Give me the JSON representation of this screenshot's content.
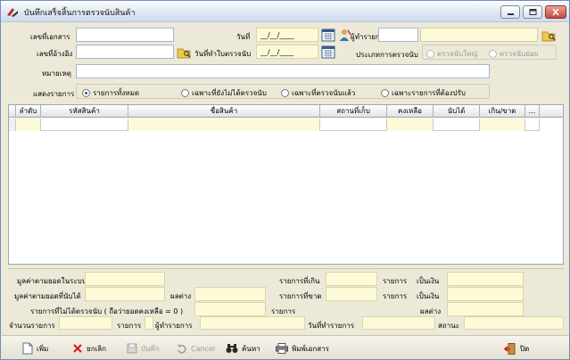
{
  "window": {
    "title": "บันทึกเสร็จสิ้นการตรวจนับสินค้า"
  },
  "form": {
    "doc_no_label": "เลขที่เอกสาร",
    "ref_no_label": "เลขที่อ้างอิง",
    "date_label": "วันที่",
    "date_value": "__/__/____",
    "count_date_label": "วันที่ทำใบตรวจนับ",
    "count_date_value": "__/__/____",
    "recorder_label": "ผู้ทำรายการ",
    "count_type_label": "ประเภทการตรวจนับ",
    "count_type_options": [
      "ตรวจนับใหญ่",
      "ตรวจนับย่อย"
    ],
    "note_label": "หมายเหตุ",
    "show_label": "แสดงรายการ",
    "show_options": [
      "รายการทั้งหมด",
      "เฉพาะที่ยังไม่ได้ตรวจนับ",
      "เฉพาะที่ตรวจนับแล้ว",
      "เฉพาะรายการที่ต้องปรับ"
    ],
    "show_selected": "รายการทั้งหมด"
  },
  "grid": {
    "columns": [
      "ลำดับ",
      "รหัสสินค้า",
      "ชื่อสินค้า",
      "สถานที่เก็บ",
      "คงเหลือ",
      "นับได้",
      "เกิน/ขาด",
      "..."
    ]
  },
  "summary": {
    "system_value_label": "มูลค่าตามยอดในระบบ",
    "counted_value_label": "มูลค่าตามยอดที่นับได้",
    "diff_label": "ผลต่าง",
    "uncounted_label": "รายการที่ไม่ได้ตรวจนับ ( ถือว่ายอดคงเหลือ = 0 )",
    "items_label": "รายการ",
    "over_label": "รายการที่เกิน",
    "short_label": "รายการที่ขาด",
    "item_word": "รายการ",
    "amount_label": "เป็นเงิน",
    "diff2_label": "ผลต่าง"
  },
  "status": {
    "count_label": "จำนวนรายการ",
    "items_label": "รายการ",
    "user_label": "ผู้ทำรายการ",
    "date_label": "วันที่ทำรายการ",
    "state_label": "สถานะ"
  },
  "toolbar": {
    "add": "เพิ่ม",
    "cancel_doc": "ยกเลิก",
    "save": "บันทึก",
    "cancel": "Cancel",
    "search": "ค้นหา",
    "print": "พิมพ์เอกสาร",
    "close": "ปิด"
  },
  "colors": {
    "accent": "#2a58b8",
    "field_yellow": "#fdfbd7"
  }
}
